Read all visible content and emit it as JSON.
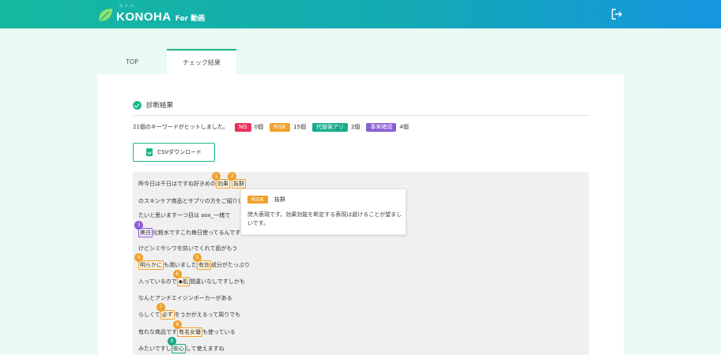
{
  "header": {
    "logo_ruby": "コノハ",
    "logo_main": "KONOHA",
    "logo_sub": "For 動画",
    "logout_icon": "logout-icon"
  },
  "tabs": [
    {
      "label": "TOP"
    },
    {
      "label": "チェック結果"
    }
  ],
  "result": {
    "title": "診断結果",
    "summary_text": "21個のキーワードがヒットしました。",
    "badges": [
      {
        "label": "NG",
        "count": "0個",
        "color": "#e8325a"
      },
      {
        "label": "RISK",
        "count": "15個",
        "color": "#f0a12c"
      },
      {
        "label": "代替案アリ",
        "count": "2個",
        "color": "#18a98a"
      },
      {
        "label": "事実確認",
        "count": "4個",
        "color": "#8b5cd6"
      }
    ],
    "csv_button": "CSVダウンロード"
  },
  "lines": [
    {
      "pre": "昨今日は千日はですね好きめの",
      "hl1": "効果",
      "n1": "1",
      "hl2": "抜群",
      "n2": "2",
      "post": ""
    },
    {
      "pre": "のスキンケア商品とサプリの方をご紹介し",
      "post": ""
    },
    {
      "pre": "たいと思います一つ目は aox_一緒で",
      "post": ""
    },
    {
      "hl": "美白",
      "n": "3",
      "post": "化粧水ですこれ毎日使ってるんです"
    },
    {
      "pre": "けどシミやシワを防いでくれて肌がもう",
      "post": ""
    },
    {
      "hl": "明らかに",
      "n": "4",
      "mid": "も潤いました",
      "hl2": "有効",
      "n2": "5",
      "post": "成分がたっぷり"
    },
    {
      "pre": "入っているので",
      "hl": "◆肌",
      "n": "6",
      "post": "間違いなしですしかも"
    },
    {
      "pre": "なんとアンチエイジンボーカーがある",
      "post": ""
    },
    {
      "pre": "らしくて",
      "hl": "必ず",
      "n": "7",
      "post": "をうかがえるって周りでも"
    },
    {
      "pre": "有れな商品です",
      "hl": "有名女優",
      "n": "8",
      "post": "も使っている"
    },
    {
      "pre": "みたいですし",
      "hl": "安心",
      "n": "9",
      "post": "して使えますね"
    }
  ],
  "tooltip": {
    "badge": "RISK",
    "word": "抜群",
    "desc": "誇大表現です。効果効能を断定する表現は避けることが望ましいです。"
  },
  "colors": {
    "accent": "#1bb58c",
    "ng": "#e8325a",
    "risk": "#f0a12c",
    "alt": "#18a98a",
    "fact": "#8b5cd6"
  }
}
